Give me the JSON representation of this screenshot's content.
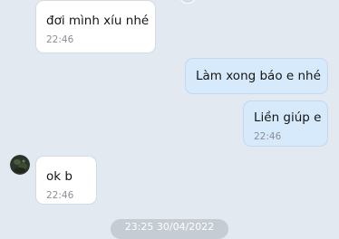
{
  "messages": [
    {
      "direction": "incoming",
      "text": "đơi mình xíu nhé",
      "time": "22:46"
    },
    {
      "direction": "outgoing",
      "text": "Làm xong báo e nhé",
      "time": ""
    },
    {
      "direction": "outgoing",
      "text": "Liền giúp e",
      "time": "22:46"
    },
    {
      "direction": "incoming",
      "text": "ok b",
      "time": "22:46"
    }
  ],
  "date_separator": "23:25 30/04/2022",
  "colors": {
    "background": "#e2e9f1",
    "incoming_bubble": "#ffffff",
    "outgoing_bubble": "#d7eafc",
    "timestamp": "#8a8f96"
  }
}
